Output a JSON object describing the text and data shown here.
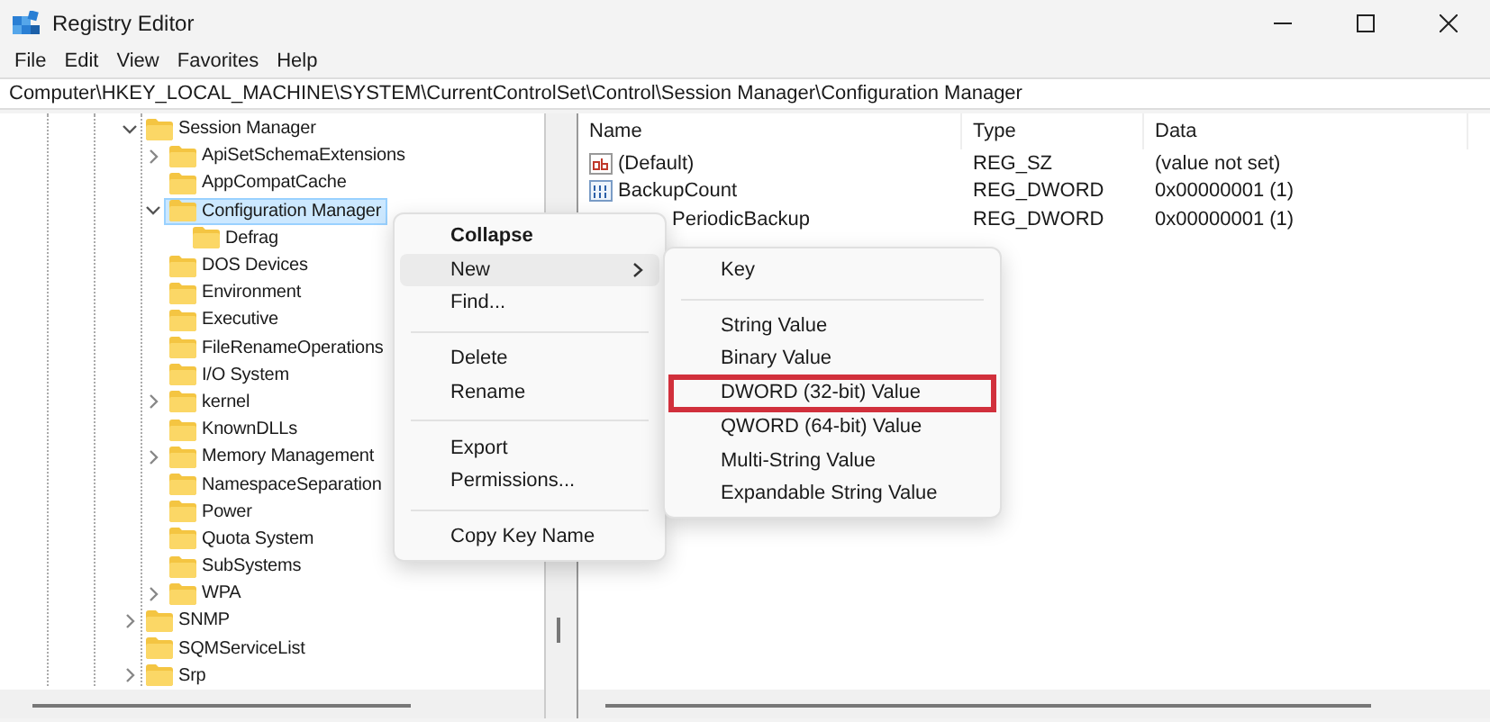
{
  "window": {
    "title": "Registry Editor"
  },
  "menu": [
    "File",
    "Edit",
    "View",
    "Favorites",
    "Help"
  ],
  "address": "Computer\\HKEY_LOCAL_MACHINE\\SYSTEM\\CurrentControlSet\\Control\\Session Manager\\Configuration Manager",
  "tree": [
    {
      "label": "Session Manager",
      "expanded": true,
      "selected": false,
      "children": [
        {
          "label": "ApiSetSchemaExtensions",
          "expanded": false,
          "selected": false
        },
        {
          "label": "AppCompatCache",
          "selected": false
        },
        {
          "label": "Configuration Manager",
          "expanded": true,
          "selected": true,
          "children": [
            {
              "label": "Defrag",
              "selected": false
            }
          ]
        },
        {
          "label": "DOS Devices",
          "selected": false
        },
        {
          "label": "Environment",
          "selected": false
        },
        {
          "label": "Executive",
          "selected": false
        },
        {
          "label": "FileRenameOperations",
          "selected": false
        },
        {
          "label": "I/O System",
          "selected": false
        },
        {
          "label": "kernel",
          "expanded": false,
          "selected": false
        },
        {
          "label": "KnownDLLs",
          "selected": false
        },
        {
          "label": "Memory Management",
          "expanded": false,
          "selected": false
        },
        {
          "label": "NamespaceSeparation",
          "selected": false
        },
        {
          "label": "Power",
          "selected": false
        },
        {
          "label": "Quota System",
          "selected": false
        },
        {
          "label": "SubSystems",
          "selected": false
        },
        {
          "label": "WPA",
          "expanded": false,
          "selected": false
        }
      ]
    },
    {
      "label": "SNMP",
      "expanded": false,
      "selected": false
    },
    {
      "label": "SQMServiceList",
      "selected": false
    },
    {
      "label": "Srp",
      "expanded": false,
      "selected": false
    }
  ],
  "table": {
    "columns": [
      "Name",
      "Type",
      "Data"
    ],
    "rows": [
      {
        "kind": "string",
        "name": "(Default)",
        "type": "REG_SZ",
        "data": "(value not set)"
      },
      {
        "kind": "binary",
        "name": "BackupCount",
        "type": "REG_DWORD",
        "data": "0x00000001 (1)"
      },
      {
        "kind": "covered",
        "name": "PeriodicBackup",
        "type": "REG_DWORD",
        "data": "0x00000001 (1)"
      }
    ]
  },
  "context_menu": [
    {
      "kind": "item",
      "label": "Collapse",
      "default": true,
      "highlighted": false
    },
    {
      "kind": "item",
      "label": "New",
      "highlighted": true,
      "submenu": true
    },
    {
      "kind": "item",
      "label": "Find...",
      "highlighted": false
    },
    {
      "kind": "separator"
    },
    {
      "kind": "item",
      "label": "Delete",
      "highlighted": false
    },
    {
      "kind": "item",
      "label": "Rename",
      "highlighted": false
    },
    {
      "kind": "separator"
    },
    {
      "kind": "item",
      "label": "Export",
      "highlighted": false
    },
    {
      "kind": "item",
      "label": "Permissions...",
      "highlighted": false
    },
    {
      "kind": "separator"
    },
    {
      "kind": "item",
      "label": "Copy Key Name",
      "highlighted": false
    }
  ],
  "submenu": [
    {
      "kind": "item",
      "label": "Key",
      "outlined": false
    },
    {
      "kind": "separator"
    },
    {
      "kind": "item",
      "label": "String Value",
      "outlined": false
    },
    {
      "kind": "item",
      "label": "Binary Value",
      "outlined": false
    },
    {
      "kind": "item",
      "label": "DWORD (32-bit) Value",
      "outlined": true
    },
    {
      "kind": "item",
      "label": "QWORD (64-bit) Value",
      "outlined": false
    },
    {
      "kind": "item",
      "label": "Multi-String Value",
      "outlined": false
    },
    {
      "kind": "item",
      "label": "Expandable String Value",
      "outlined": false
    }
  ]
}
